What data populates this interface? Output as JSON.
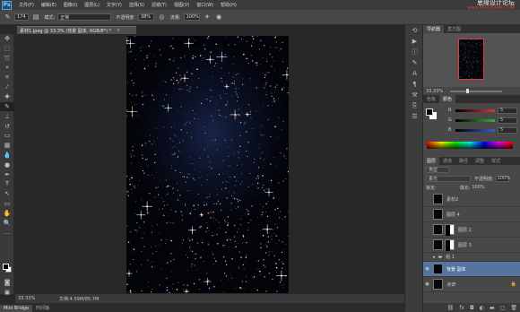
{
  "app": {
    "logo": "Ps"
  },
  "menu": [
    "文件(F)",
    "编辑(E)",
    "图像(I)",
    "图层(L)",
    "文字(Y)",
    "选择(S)",
    "滤镜(T)",
    "视图(V)",
    "窗口(W)",
    "帮助(H)"
  ],
  "watermark": {
    "line1": "思缘设计论坛",
    "line2": "www.MISSYUAN.COM"
  },
  "options": {
    "brush_size": "174",
    "mode_label": "模式:",
    "mode_value": "正常",
    "opacity_label": "不透明度:",
    "opacity_value": "38%",
    "flow_label": "流量:",
    "flow_value": "100%"
  },
  "document": {
    "tab_title": "素材1.jpeg @ 33.3% (背景 副本, RGB/8*) *",
    "close": "×"
  },
  "status": {
    "zoom": "33.33%",
    "doc": "文档:4.59M/85.7M"
  },
  "bottom_tabs": [
    "Mini Bridge",
    "时间轴"
  ],
  "navigator": {
    "tabs": [
      "导航器",
      "直方图"
    ],
    "zoom": "33.33%"
  },
  "color": {
    "tabs": [
      "色板",
      "颜色"
    ],
    "channels": [
      {
        "label": "R",
        "value": "5",
        "color": "#d23a3a"
      },
      {
        "label": "G",
        "value": "5",
        "color": "#35b035"
      },
      {
        "label": "B",
        "value": "5",
        "color": "#3a5ad2"
      }
    ]
  },
  "layers": {
    "tabs": [
      "图层",
      "通道",
      "路径",
      "调整",
      "样式"
    ],
    "filter": "类型",
    "mode": "柔光",
    "opacity_label": "不透明度:",
    "opacity": "100%",
    "lock_label": "锁定:",
    "fill_label": "填充:",
    "fill": "100%",
    "rows": [
      {
        "name": "素材2",
        "type": "normal",
        "visible": false
      },
      {
        "name": "图层 4",
        "type": "normal",
        "visible": false
      },
      {
        "name": "图层 2",
        "type": "mask",
        "visible": false
      },
      {
        "name": "图层 3",
        "type": "mask",
        "visible": false
      },
      {
        "name": "组 1",
        "type": "group",
        "visible": false
      },
      {
        "name": "背景 副本",
        "type": "normal",
        "visible": true,
        "selected": true
      },
      {
        "name": "背景",
        "type": "locked",
        "visible": true
      }
    ]
  }
}
